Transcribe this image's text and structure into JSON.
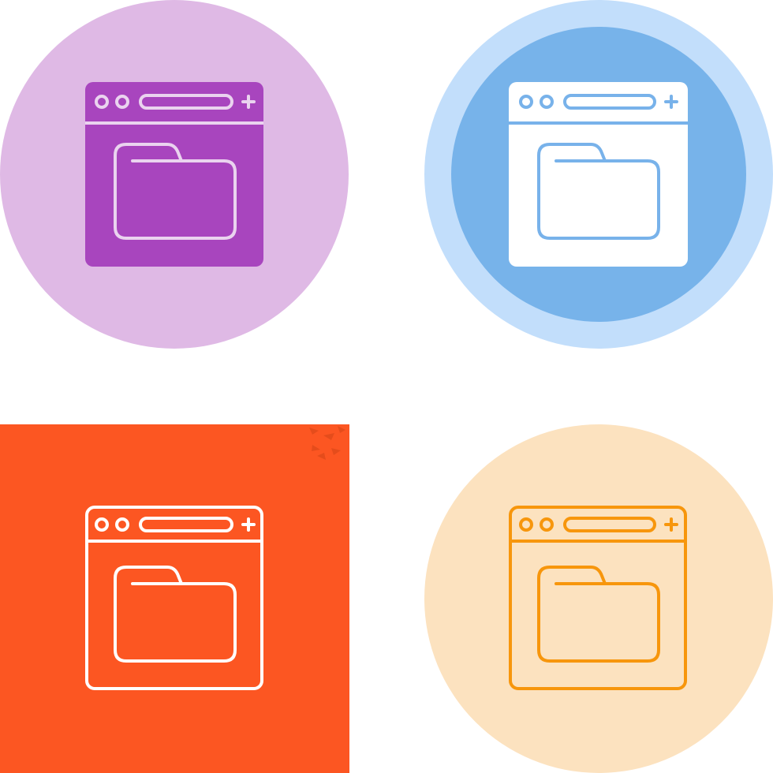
{
  "icons": [
    {
      "id": "variant-glyph-purple",
      "style": "glyph",
      "background_shape": "circle",
      "background_color": "#dfb9e5",
      "window_fill": "#a845be",
      "line_color": "#ead3ef"
    },
    {
      "id": "variant-glyph-blue",
      "style": "glyph",
      "background_shape": "circle",
      "background_outer_color": "#c2defb",
      "background_inner_color": "#77b3ea",
      "window_fill": "#ffffff",
      "line_color": "#78b2ea"
    },
    {
      "id": "variant-line-red-square",
      "style": "line",
      "background_shape": "square",
      "background_color": "#fc5622",
      "line_color": "#ffffff"
    },
    {
      "id": "variant-line-orange",
      "style": "line",
      "background_shape": "circle",
      "background_color": "#fce2bf",
      "line_color": "#f7960c"
    }
  ],
  "icon_name": "browser-folder-icon"
}
